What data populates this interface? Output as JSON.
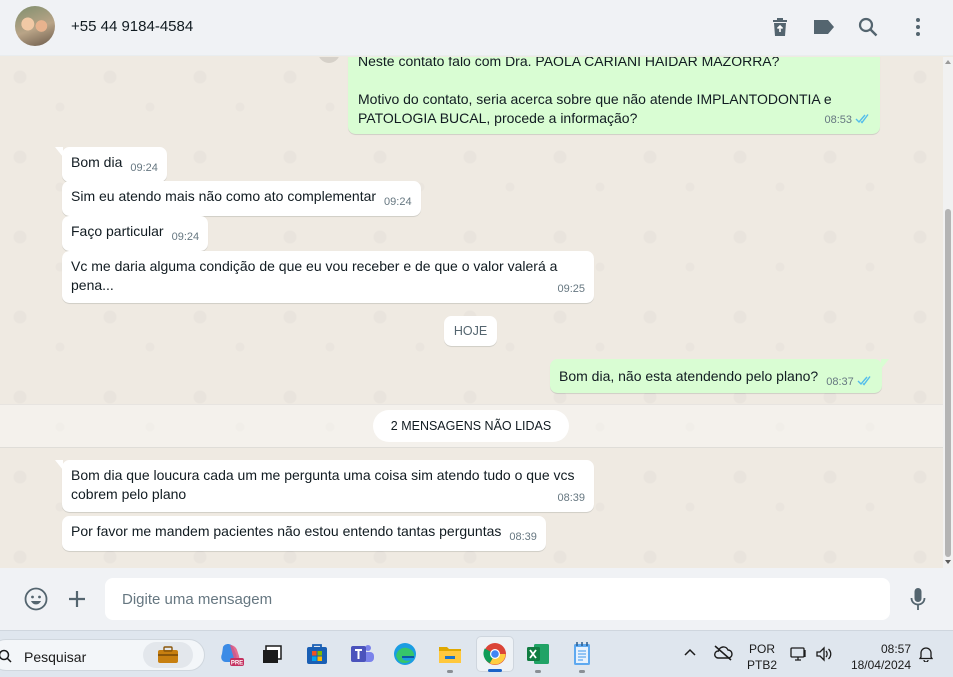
{
  "header": {
    "contact_name": "+55 44 9184-4584",
    "icons": [
      "delete-icon",
      "label-icon",
      "search-icon",
      "menu-icon"
    ]
  },
  "messages": {
    "m0": {
      "direction": "out",
      "text_l1": "Neste contato falo com Dra. PAOLA CARIANI HAIDAR MAZORRA?",
      "text_l2": "Motivo do contato, seria acerca sobre que não atende IMPLANTODONTIA e",
      "text_l3": "PATOLOGIA BUCAL, procede a informação?",
      "time": "08:53",
      "status": "read"
    },
    "m1": {
      "direction": "in",
      "text": "Bom dia",
      "time": "09:24"
    },
    "m2": {
      "direction": "in",
      "text": "Sim eu atendo mais não como ato complementar",
      "time": "09:24"
    },
    "m3": {
      "direction": "in",
      "text": "Faço particular",
      "time": "09:24"
    },
    "m4": {
      "direction": "in",
      "text_l1": "Vc me daria alguma condição de que eu vou receber e de que o valor valerá a",
      "text_l2": "pena...",
      "time": "09:25"
    },
    "m5": {
      "direction": "out",
      "text": "Bom dia, não esta atendendo pelo plano?",
      "time": "08:37",
      "status": "read"
    },
    "m6": {
      "direction": "in",
      "text_l1": "Bom dia que loucura cada um me pergunta uma coisa sim atendo tudo o que vcs",
      "text_l2": "cobrem pelo plano",
      "time": "08:39"
    },
    "m7": {
      "direction": "in",
      "text": "Por favor me mandem pacientes não estou entendo tantas perguntas",
      "time": "08:39"
    }
  },
  "date_divider": "HOJE",
  "unread_divider": "2 MENSAGENS NÃO LIDAS",
  "footer": {
    "placeholder": "Digite uma mensagem",
    "icons": [
      "emoji-icon",
      "plus-icon",
      "microphone-icon"
    ]
  },
  "taskbar": {
    "search_label": "Pesquisar",
    "apps": [
      "work-icon",
      "copilot-icon",
      "task-view-icon",
      "store-icon",
      "teams-icon",
      "edge-icon",
      "file-explorer-icon",
      "chrome-icon",
      "excel-icon",
      "notepad-icon"
    ],
    "language": {
      "line1": "POR",
      "line2": "PTB2"
    },
    "clock": {
      "time": "08:57",
      "date": "18/04/2024"
    }
  },
  "colors": {
    "incoming_bubble": "#ffffff",
    "outgoing_bubble": "#d9fdd3",
    "read_ticks": "#53bdeb",
    "chat_background": "#efeae2"
  }
}
